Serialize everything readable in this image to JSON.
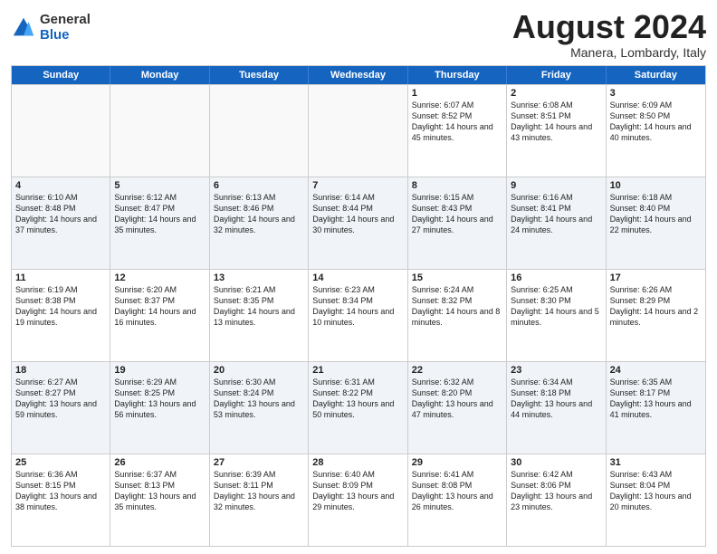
{
  "header": {
    "logo_general": "General",
    "logo_blue": "Blue",
    "month_title": "August 2024",
    "location": "Manera, Lombardy, Italy"
  },
  "weekdays": [
    "Sunday",
    "Monday",
    "Tuesday",
    "Wednesday",
    "Thursday",
    "Friday",
    "Saturday"
  ],
  "rows": [
    {
      "alt": false,
      "cells": [
        {
          "day": "",
          "sunrise": "",
          "sunset": "",
          "daylight": "",
          "empty": true
        },
        {
          "day": "",
          "sunrise": "",
          "sunset": "",
          "daylight": "",
          "empty": true
        },
        {
          "day": "",
          "sunrise": "",
          "sunset": "",
          "daylight": "",
          "empty": true
        },
        {
          "day": "",
          "sunrise": "",
          "sunset": "",
          "daylight": "",
          "empty": true
        },
        {
          "day": "1",
          "sunrise": "Sunrise: 6:07 AM",
          "sunset": "Sunset: 8:52 PM",
          "daylight": "Daylight: 14 hours and 45 minutes."
        },
        {
          "day": "2",
          "sunrise": "Sunrise: 6:08 AM",
          "sunset": "Sunset: 8:51 PM",
          "daylight": "Daylight: 14 hours and 43 minutes."
        },
        {
          "day": "3",
          "sunrise": "Sunrise: 6:09 AM",
          "sunset": "Sunset: 8:50 PM",
          "daylight": "Daylight: 14 hours and 40 minutes."
        }
      ]
    },
    {
      "alt": true,
      "cells": [
        {
          "day": "4",
          "sunrise": "Sunrise: 6:10 AM",
          "sunset": "Sunset: 8:48 PM",
          "daylight": "Daylight: 14 hours and 37 minutes."
        },
        {
          "day": "5",
          "sunrise": "Sunrise: 6:12 AM",
          "sunset": "Sunset: 8:47 PM",
          "daylight": "Daylight: 14 hours and 35 minutes."
        },
        {
          "day": "6",
          "sunrise": "Sunrise: 6:13 AM",
          "sunset": "Sunset: 8:46 PM",
          "daylight": "Daylight: 14 hours and 32 minutes."
        },
        {
          "day": "7",
          "sunrise": "Sunrise: 6:14 AM",
          "sunset": "Sunset: 8:44 PM",
          "daylight": "Daylight: 14 hours and 30 minutes."
        },
        {
          "day": "8",
          "sunrise": "Sunrise: 6:15 AM",
          "sunset": "Sunset: 8:43 PM",
          "daylight": "Daylight: 14 hours and 27 minutes."
        },
        {
          "day": "9",
          "sunrise": "Sunrise: 6:16 AM",
          "sunset": "Sunset: 8:41 PM",
          "daylight": "Daylight: 14 hours and 24 minutes."
        },
        {
          "day": "10",
          "sunrise": "Sunrise: 6:18 AM",
          "sunset": "Sunset: 8:40 PM",
          "daylight": "Daylight: 14 hours and 22 minutes."
        }
      ]
    },
    {
      "alt": false,
      "cells": [
        {
          "day": "11",
          "sunrise": "Sunrise: 6:19 AM",
          "sunset": "Sunset: 8:38 PM",
          "daylight": "Daylight: 14 hours and 19 minutes."
        },
        {
          "day": "12",
          "sunrise": "Sunrise: 6:20 AM",
          "sunset": "Sunset: 8:37 PM",
          "daylight": "Daylight: 14 hours and 16 minutes."
        },
        {
          "day": "13",
          "sunrise": "Sunrise: 6:21 AM",
          "sunset": "Sunset: 8:35 PM",
          "daylight": "Daylight: 14 hours and 13 minutes."
        },
        {
          "day": "14",
          "sunrise": "Sunrise: 6:23 AM",
          "sunset": "Sunset: 8:34 PM",
          "daylight": "Daylight: 14 hours and 10 minutes."
        },
        {
          "day": "15",
          "sunrise": "Sunrise: 6:24 AM",
          "sunset": "Sunset: 8:32 PM",
          "daylight": "Daylight: 14 hours and 8 minutes."
        },
        {
          "day": "16",
          "sunrise": "Sunrise: 6:25 AM",
          "sunset": "Sunset: 8:30 PM",
          "daylight": "Daylight: 14 hours and 5 minutes."
        },
        {
          "day": "17",
          "sunrise": "Sunrise: 6:26 AM",
          "sunset": "Sunset: 8:29 PM",
          "daylight": "Daylight: 14 hours and 2 minutes."
        }
      ]
    },
    {
      "alt": true,
      "cells": [
        {
          "day": "18",
          "sunrise": "Sunrise: 6:27 AM",
          "sunset": "Sunset: 8:27 PM",
          "daylight": "Daylight: 13 hours and 59 minutes."
        },
        {
          "day": "19",
          "sunrise": "Sunrise: 6:29 AM",
          "sunset": "Sunset: 8:25 PM",
          "daylight": "Daylight: 13 hours and 56 minutes."
        },
        {
          "day": "20",
          "sunrise": "Sunrise: 6:30 AM",
          "sunset": "Sunset: 8:24 PM",
          "daylight": "Daylight: 13 hours and 53 minutes."
        },
        {
          "day": "21",
          "sunrise": "Sunrise: 6:31 AM",
          "sunset": "Sunset: 8:22 PM",
          "daylight": "Daylight: 13 hours and 50 minutes."
        },
        {
          "day": "22",
          "sunrise": "Sunrise: 6:32 AM",
          "sunset": "Sunset: 8:20 PM",
          "daylight": "Daylight: 13 hours and 47 minutes."
        },
        {
          "day": "23",
          "sunrise": "Sunrise: 6:34 AM",
          "sunset": "Sunset: 8:18 PM",
          "daylight": "Daylight: 13 hours and 44 minutes."
        },
        {
          "day": "24",
          "sunrise": "Sunrise: 6:35 AM",
          "sunset": "Sunset: 8:17 PM",
          "daylight": "Daylight: 13 hours and 41 minutes."
        }
      ]
    },
    {
      "alt": false,
      "cells": [
        {
          "day": "25",
          "sunrise": "Sunrise: 6:36 AM",
          "sunset": "Sunset: 8:15 PM",
          "daylight": "Daylight: 13 hours and 38 minutes."
        },
        {
          "day": "26",
          "sunrise": "Sunrise: 6:37 AM",
          "sunset": "Sunset: 8:13 PM",
          "daylight": "Daylight: 13 hours and 35 minutes."
        },
        {
          "day": "27",
          "sunrise": "Sunrise: 6:39 AM",
          "sunset": "Sunset: 8:11 PM",
          "daylight": "Daylight: 13 hours and 32 minutes."
        },
        {
          "day": "28",
          "sunrise": "Sunrise: 6:40 AM",
          "sunset": "Sunset: 8:09 PM",
          "daylight": "Daylight: 13 hours and 29 minutes."
        },
        {
          "day": "29",
          "sunrise": "Sunrise: 6:41 AM",
          "sunset": "Sunset: 8:08 PM",
          "daylight": "Daylight: 13 hours and 26 minutes."
        },
        {
          "day": "30",
          "sunrise": "Sunrise: 6:42 AM",
          "sunset": "Sunset: 8:06 PM",
          "daylight": "Daylight: 13 hours and 23 minutes."
        },
        {
          "day": "31",
          "sunrise": "Sunrise: 6:43 AM",
          "sunset": "Sunset: 8:04 PM",
          "daylight": "Daylight: 13 hours and 20 minutes."
        }
      ]
    }
  ]
}
